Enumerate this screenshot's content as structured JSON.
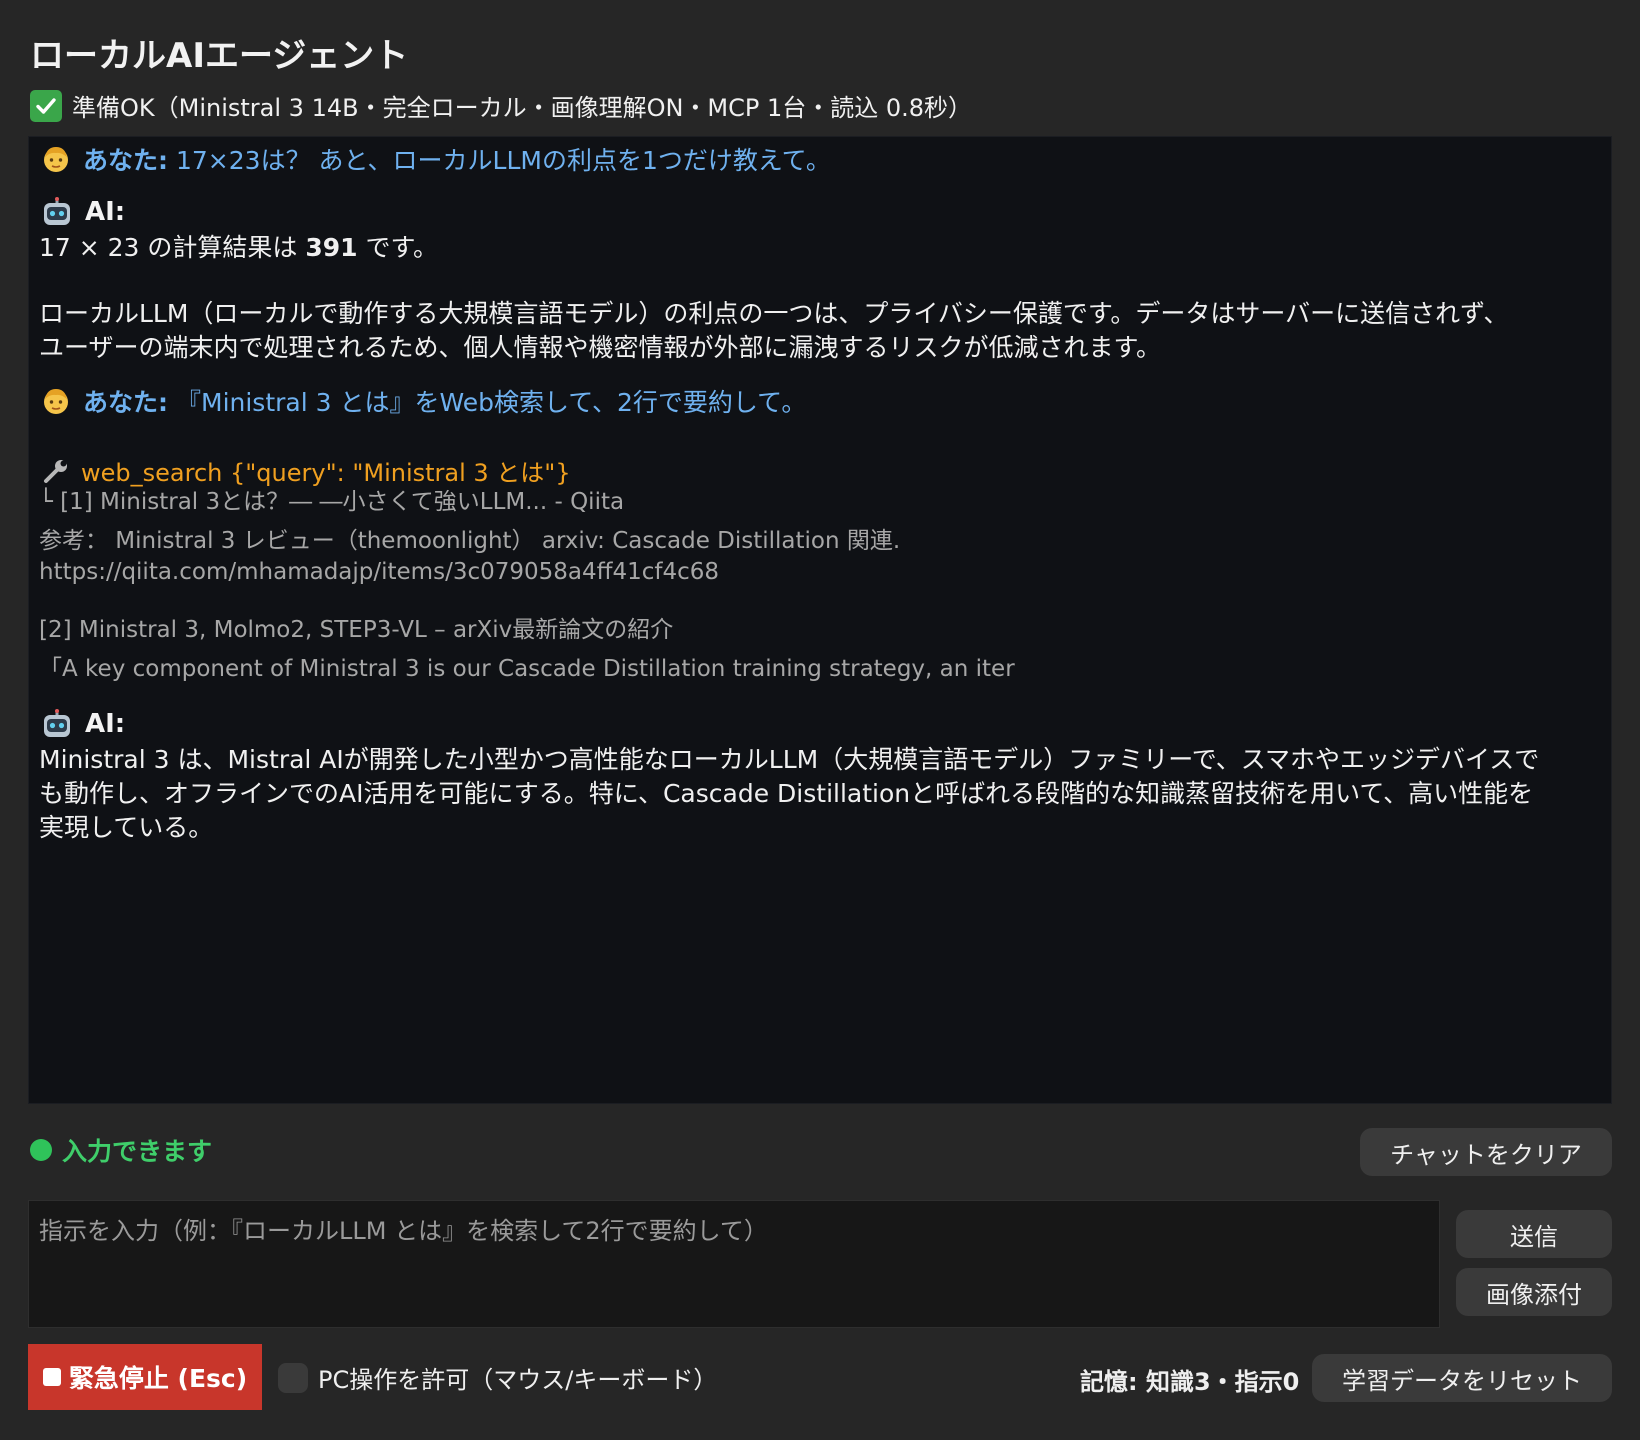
{
  "header": {
    "title": "ローカルAIエージェント",
    "status": "準備OK（Ministral 3 14B・完全ローカル・画像理解ON・MCP 1台・読込 0.8秒）"
  },
  "icons": {
    "status": "check-icon",
    "user": "face-icon",
    "ai": "robot-icon",
    "tool": "wrench-icon",
    "stop": "stop-square-icon"
  },
  "chat": {
    "messages": [
      {
        "who": "あなた:",
        "text": "17×23は？ あと、ローカルLLMの利点を1つだけ教えて。"
      },
      {
        "who": "AI:",
        "line1_pre": "17 × 23 の計算結果は ",
        "line1_bold": "391",
        "line1_post": " です。",
        "para2_line1": "ローカルLLM（ローカルで動作する大規模言語モデル）の利点の一つは、プライバシー保護です。データはサーバーに送信されず、",
        "para2_line2": "ユーザーの端末内で処理されるため、個人情報や機密情報が外部に漏洩するリスクが低減されます。"
      },
      {
        "who": "あなた:",
        "text": "『Ministral 3 とは』をWeb検索して、2行で要約して。"
      },
      {
        "tool_call": "web_search {\"query\": \"Ministral 3 とは\"}"
      },
      {
        "result1_title": "└ [1] Ministral 3とは？― ―小さくて強いLLM... - Qiita",
        "result1_line2": "参考： Ministral 3 レビュー（themoonlight） arxiv: Cascade Distillation 関連.",
        "result1_url": "https://qiita.com/mhamadajp/items/3c079058a4ff41cf4c68",
        "result2_title": "[2] Ministral 3, Molmo2, STEP3-VL – arXiv最新論文の紹介",
        "result2_line2": "「A key component of Ministral 3 is our Cascade Distillation training strategy, an iter"
      },
      {
        "who": "AI:",
        "line1": "Ministral 3 は、Mistral AIが開発した小型かつ高性能なローカルLLM（大規模言語モデル）ファミリーで、スマホやエッジデバイスで",
        "line2": "も動作し、オフラインでのAI活用を可能にする。特に、Cascade Distillationと呼ばれる段階的な知識蒸留技術を用いて、高い性能を",
        "line3": "実現している。"
      }
    ]
  },
  "controls": {
    "input_status": "入力できます",
    "clear_label": "チャットをクリア",
    "input_placeholder": "指示を入力（例：『ローカルLLM とは』を検索して2行で要約して）",
    "input_value": "",
    "send_label": "送信",
    "attach_label": "画像添付",
    "stop_label": "緊急停止 (Esc)",
    "pc_control_label": "PC操作を許可（マウス/キーボード）",
    "pc_control_checked": false,
    "memory_text": "記憶: 知識3・指示0",
    "reset_label": "学習データをリセット"
  },
  "colors": {
    "user_text": "#6fb1ef",
    "tool_text": "#f0a020",
    "ready_green": "#3fce6a",
    "stop_red": "#c8362b"
  }
}
